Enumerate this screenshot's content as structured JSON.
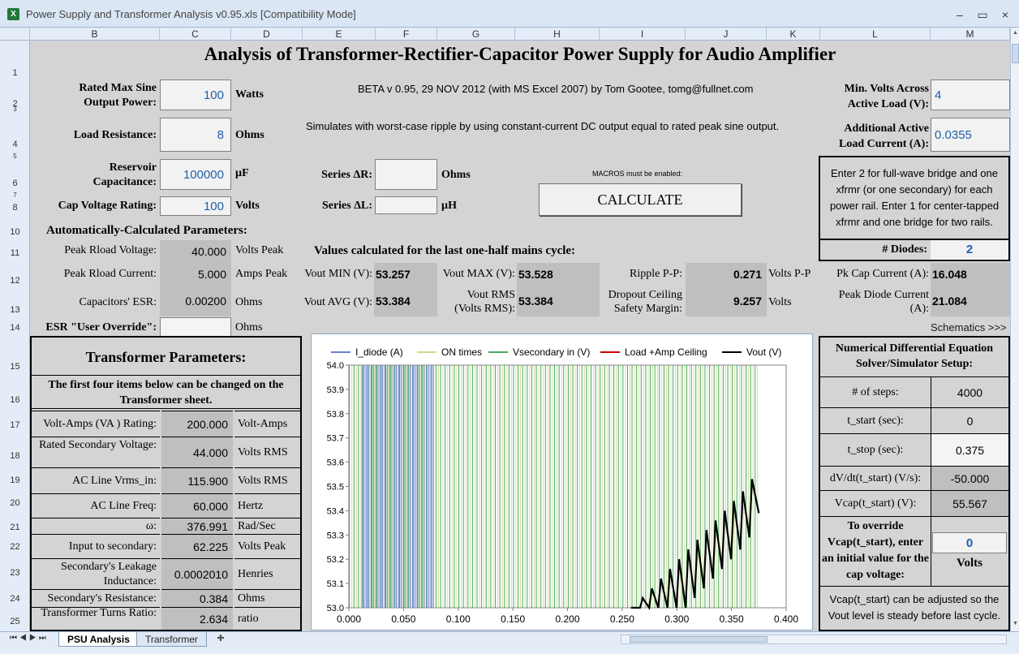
{
  "window": {
    "title": "Power Supply and Transformer Analysis v0.95.xls  [Compatibility Mode]",
    "app_icon": "X"
  },
  "columns": [
    "B",
    "C",
    "D",
    "E",
    "F",
    "G",
    "H",
    "I",
    "J",
    "K",
    "L",
    "M"
  ],
  "rows": [
    "1",
    "2",
    "3",
    "4",
    "5",
    "6",
    "7",
    "8",
    "10",
    "11",
    "12",
    "13",
    "14",
    "15",
    "16",
    "17",
    "18",
    "19",
    "20",
    "21",
    "22",
    "23",
    "24",
    "25"
  ],
  "sheet": {
    "title": "Analysis of Transformer-Rectifier-Capacitor Power Supply for Audio Amplifier",
    "beta": "BETA v 0.95, 29 NOV 2012 (with MS Excel 2007) by Tom Gootee, tomg@fullnet.com",
    "simulates": "Simulates with worst-case ripple by using constant-current DC output equal to rated peak sine output.",
    "macros_note": "MACROS must be enabled:",
    "calculate_label": "CALCULATE",
    "schematics_link": "Schematics >>>"
  },
  "inputs": {
    "power_label": "Rated Max Sine Output Power:",
    "power": "100",
    "power_unit": "Watts",
    "load_label": "Load Resistance:",
    "load": "8",
    "load_unit": "Ohms",
    "cap_label": "Reservoir Capacitance:",
    "cap": "100000",
    "cap_unit": "µF",
    "capv_label": "Cap Voltage Rating:",
    "capv": "100",
    "capv_unit": "Volts",
    "sr_label": "Series ΔR:",
    "sr": "",
    "sr_unit": "Ohms",
    "sl_label": "Series ΔL:",
    "sl": "",
    "sl_unit": "µH",
    "minv_label": "Min. Volts Across Active Load (V):",
    "minv": "4",
    "addi_label": "Additional Active Load Current  (A):",
    "addi": "0.0355",
    "diodes_note": "Enter 2 for full-wave bridge and one xfrmr (or one secondary) for each power rail. Enter 1 for center-tapped xfrmr and one bridge for two rails.",
    "diodes_label": "# Diodes:",
    "diodes": "2"
  },
  "auto": {
    "header": "Automatically-Calculated Parameters:",
    "peak_v_label": "Peak Rload Voltage:",
    "peak_v": "40.000",
    "peak_v_unit": "Volts Peak",
    "peak_i_label": "Peak Rload Current:",
    "peak_i": "5.000",
    "peak_i_unit": "Amps Peak",
    "esr_label": "Capacitors' ESR:",
    "esr": "0.00200",
    "esr_unit": "Ohms",
    "esr_override_label": "ESR \"User Override\":",
    "esr_override": "",
    "esr_override_unit": "Ohms"
  },
  "cycle": {
    "header": "Values calculated for the last one-half mains cycle:",
    "vmin_label": "Vout MIN (V):",
    "vmin": "53.257",
    "vmax_label": "Vout MAX (V):",
    "vmax": "53.528",
    "ripple_label": "Ripple P-P:",
    "ripple": "0.271",
    "ripple_unit": "Volts P-P",
    "pkcap_label": "Pk Cap Current (A):",
    "pkcap": "16.048",
    "vavg_label": "Vout AVG (V):",
    "vavg": "53.384",
    "vrms_label": "Vout RMS (Volts RMS):",
    "vrms": "53.384",
    "dropout_label": "Dropout Ceiling Safety Margin:",
    "dropout": "9.257",
    "dropout_unit": "Volts",
    "pkdiode_label": "Peak Diode Current (A):",
    "pkdiode": "21.084"
  },
  "transformer": {
    "header": "Transformer Parameters:",
    "note": "The first four items below can be changed  on the Transformer sheet.",
    "rows": [
      {
        "label": "Volt-Amps (VA ) Rating:",
        "value": "200.000",
        "unit": "Volt-Amps"
      },
      {
        "label": "Rated Secondary Voltage:",
        "value": "44.000",
        "unit": "Volts RMS"
      },
      {
        "label": "AC Line Vrms_in:",
        "value": "115.900",
        "unit": "Volts RMS"
      },
      {
        "label": "AC Line Freq:",
        "value": "60.000",
        "unit": "Hertz"
      },
      {
        "label": "ω:",
        "value": "376.991",
        "unit": "Rad/Sec"
      },
      {
        "label": "Input to secondary:",
        "value": "62.225",
        "unit": "Volts Peak"
      },
      {
        "label": "Secondary's Leakage Inductance:",
        "value": "0.0002010",
        "unit": "Henries"
      },
      {
        "label": "Secondary's Resistance:",
        "value": "0.384",
        "unit": "Ohms"
      },
      {
        "label": "Transformer Turns Ratio:",
        "value": "2.634",
        "unit": "ratio"
      }
    ]
  },
  "solver": {
    "header": "Numerical Differential Equation Solver/Simulator Setup:",
    "rows": [
      {
        "label": "# of steps:",
        "value": "4000"
      },
      {
        "label": "t_start (sec):",
        "value": "0"
      },
      {
        "label": "t_stop (sec):",
        "value": "0.375"
      },
      {
        "label": "dV/dt(t_start) (V/s):",
        "value": "-50.000"
      },
      {
        "label": "Vcap(t_start) (V):",
        "value": "55.567"
      }
    ],
    "override_label": "To override Vcap(t_start), enter an initial value for the cap voltage:",
    "override_value": "0",
    "override_unit": "Volts",
    "adjust_note": "Vcap(t_start) can be adjusted so the Vout level is steady before last cycle."
  },
  "tabs": [
    {
      "label": "PSU Analysis",
      "active": true
    },
    {
      "label": "Transformer",
      "active": false
    }
  ],
  "chart_data": {
    "type": "line",
    "legend": [
      "I_diode (A)",
      "ON times",
      "Vsecondary in (V)",
      "Load +Amp Ceiling",
      "Vout (V)"
    ],
    "legend_position": "top",
    "colors": {
      "I_diode (A)": "#6a7fd0",
      "ON times": "#c8dc8c",
      "Vsecondary in (V)": "#49a860",
      "Load +Amp Ceiling": "#cc0000",
      "Vout (V)": "#000000"
    },
    "xlim": [
      0.0,
      0.4
    ],
    "ylim": [
      53.0,
      54.0
    ],
    "x_ticks": [
      "0.000",
      "0.050",
      "0.100",
      "0.150",
      "0.200",
      "0.250",
      "0.300",
      "0.350",
      "0.400"
    ],
    "y_ticks": [
      "53.0",
      "53.1",
      "53.2",
      "53.3",
      "53.4",
      "53.5",
      "53.6",
      "53.7",
      "53.8",
      "53.9",
      "54.0"
    ],
    "vout_start": 0.258,
    "vout_end": 0.375,
    "vout_period": 0.00833,
    "vout_peaks": [
      53.0,
      53.04,
      53.08,
      53.12,
      53.16,
      53.2,
      53.24,
      53.28,
      53.32,
      53.36,
      53.4,
      53.44,
      53.48,
      53.53
    ],
    "vout_ripple": 0.24,
    "diode_lines_xmax": 0.078,
    "green_lines_period": 0.00417
  }
}
